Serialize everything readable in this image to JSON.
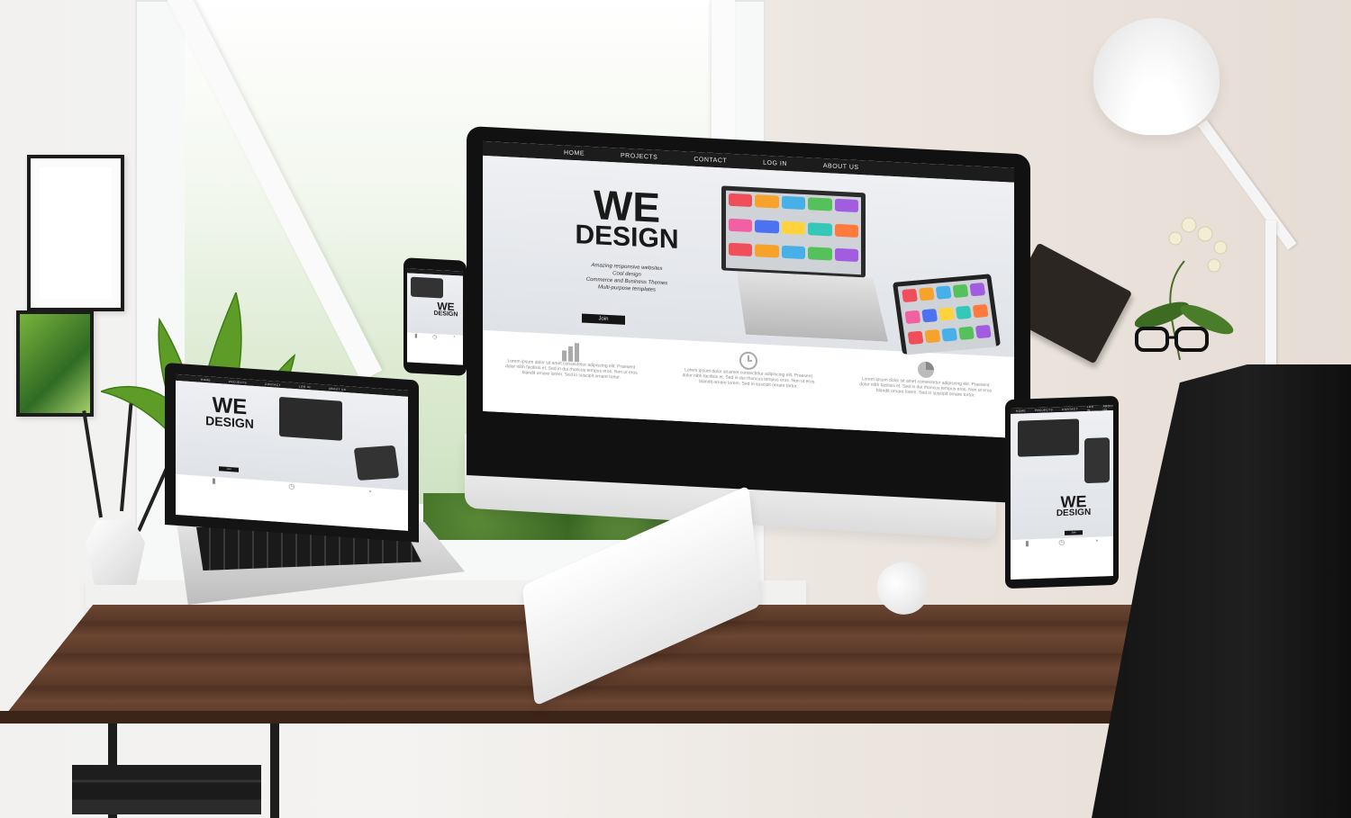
{
  "site": {
    "nav": [
      "HOME",
      "PROJECTS",
      "CONTACT",
      "LOG IN",
      "ABOUT US"
    ],
    "headline_line1": "WE",
    "headline_line2": "DESIGN",
    "taglines": [
      "Amazing responsive websites",
      "Cool design",
      "Commerce and Business Themes",
      "Multi-purpose templates"
    ],
    "join_label": "Join",
    "features": [
      {
        "icon": "bar-chart-icon",
        "text": "Lorem ipsum dolor sit amet consectetur adipiscing elit. Praesent dolor nibh facilisis et. Sed in dui rhoncus tempus eros. Non ut eros blandit ornare lorem. Sed in suscipit ornare tortor."
      },
      {
        "icon": "clock-icon",
        "text": "Lorem ipsum dolor sit amet consectetur adipiscing elit. Praesent dolor nibh facilisis et. Sed in dui rhoncus tempus eros. Non ut eros blandit ornare lorem. Sed in suscipit ornare tortor."
      },
      {
        "icon": "pie-chart-icon",
        "text": "Lorem ipsum dolor sit amet consectetur adipiscing elit. Praesent dolor nibh facilisis et. Sed in dui rhoncus tempus eros. Non ut eros blandit ornare lorem. Sed in suscipit ornare tortor."
      }
    ]
  },
  "colors": {
    "nav_bg": "#1c1c1c",
    "headline": "#1a1a1a",
    "desk_wood": "#5a3928",
    "chair": "#141414",
    "app_tiles": [
      "#f04e5b",
      "#f7a32b",
      "#48b0e8",
      "#55c15b",
      "#a25ce0",
      "#f25fa3",
      "#4b73f0",
      "#ffd33d",
      "#35c7b7",
      "#ff7a3d"
    ]
  }
}
